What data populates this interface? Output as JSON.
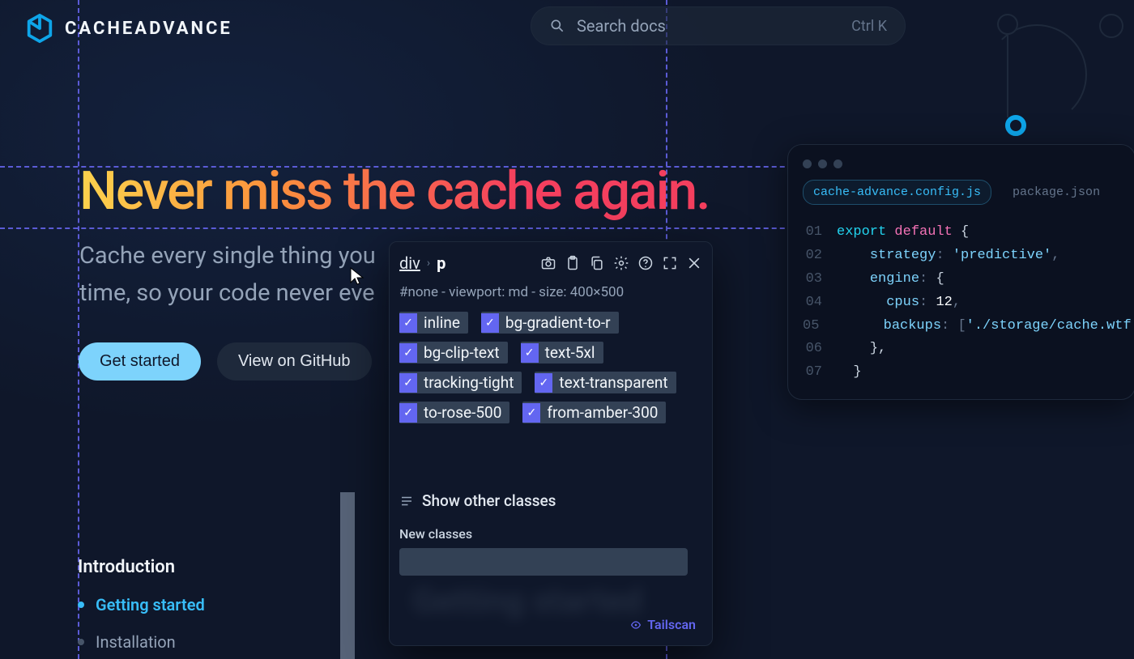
{
  "brand": {
    "name": "CACHEADVANCE"
  },
  "search": {
    "placeholder": "Search docs",
    "shortcut": "Ctrl K"
  },
  "hero": {
    "title": "Never miss the cache again.",
    "subtitle_l1": "Cache every single thing you",
    "subtitle_l2": "time, so your code never eve"
  },
  "cta": {
    "primary": "Get started",
    "secondary": "View on GitHub"
  },
  "nav": {
    "section": "Introduction",
    "items": [
      {
        "label": "Getting started",
        "active": true
      },
      {
        "label": "Installation",
        "active": false
      }
    ]
  },
  "inspector": {
    "breadcrumb": {
      "parent": "div",
      "current": "p"
    },
    "meta": "#none - viewport: md - size: 400×500",
    "classes": [
      "inline",
      "bg-gradient-to-r",
      "bg-clip-text",
      "text-5xl",
      "tracking-tight",
      "text-transparent",
      "to-rose-500",
      "from-amber-300"
    ],
    "show_other_label": "Show other classes",
    "new_classes_label": "New classes",
    "badge": "Tailscan",
    "blurred": "Getting started"
  },
  "code": {
    "tabs": [
      "cache-advance.config.js",
      "package.json"
    ],
    "active_tab": 0,
    "lines": [
      {
        "n": "01",
        "tokens": [
          [
            "kw",
            "export"
          ],
          [
            "sp",
            " "
          ],
          [
            "kw2",
            "default"
          ],
          [
            "sp",
            " "
          ],
          [
            "brace",
            "{"
          ]
        ]
      },
      {
        "n": "02",
        "tokens": [
          [
            "sp",
            "    "
          ],
          [
            "key",
            "strategy"
          ],
          [
            "punct",
            ":"
          ],
          [
            "sp",
            " "
          ],
          [
            "str",
            "'predictive'"
          ],
          [
            "punct",
            ","
          ]
        ]
      },
      {
        "n": "03",
        "tokens": [
          [
            "sp",
            "    "
          ],
          [
            "key",
            "engine"
          ],
          [
            "punct",
            ":"
          ],
          [
            "sp",
            " "
          ],
          [
            "brace",
            "{"
          ]
        ]
      },
      {
        "n": "04",
        "tokens": [
          [
            "sp",
            "      "
          ],
          [
            "key",
            "cpus"
          ],
          [
            "punct",
            ":"
          ],
          [
            "sp",
            " "
          ],
          [
            "num",
            "12"
          ],
          [
            "punct",
            ","
          ]
        ]
      },
      {
        "n": "05",
        "tokens": [
          [
            "sp",
            "      "
          ],
          [
            "key",
            "backups"
          ],
          [
            "punct",
            ":"
          ],
          [
            "sp",
            " "
          ],
          [
            "punct",
            "["
          ],
          [
            "str",
            "'./storage/cache.wtf'"
          ],
          [
            "punct",
            "],"
          ]
        ]
      },
      {
        "n": "06",
        "tokens": [
          [
            "sp",
            "    "
          ],
          [
            "brace",
            "},"
          ]
        ]
      },
      {
        "n": "07",
        "tokens": [
          [
            "sp",
            "  "
          ],
          [
            "brace",
            "}"
          ]
        ]
      }
    ]
  }
}
